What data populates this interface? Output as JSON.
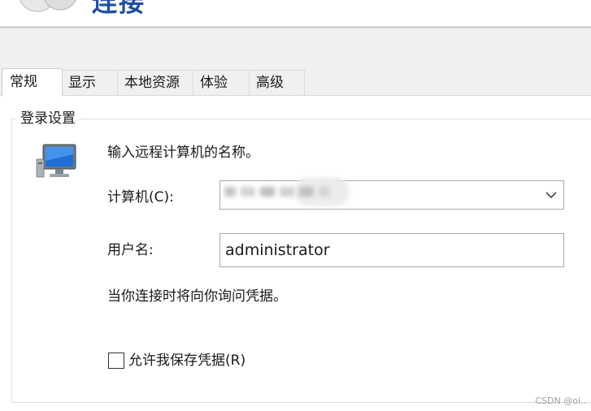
{
  "header": {
    "title": "连接",
    "icon": "remote-desktop-icon"
  },
  "tabs": [
    {
      "label": "常规",
      "active": true
    },
    {
      "label": "显示",
      "active": false
    },
    {
      "label": "本地资源",
      "active": false
    },
    {
      "label": "体验",
      "active": false
    },
    {
      "label": "高级",
      "active": false
    }
  ],
  "login_settings": {
    "group_title": "登录设置",
    "icon": "computer-monitor-icon",
    "instruction": "输入远程计算机的名称。",
    "computer_label": "计算机(C):",
    "computer_value": "",
    "username_label": "用户名:",
    "username_value": "administrator",
    "credential_note": "当你连接时将向你询问凭据。",
    "save_credentials_label": "允许我保存凭据(R)",
    "save_credentials_checked": false
  },
  "watermark": "CSDN @oi..",
  "colors": {
    "title_blue": "#1f4fa0",
    "dialog_bg": "#f0f0f0",
    "panel_bg": "#ffffff",
    "border": "#a8a8a8"
  }
}
